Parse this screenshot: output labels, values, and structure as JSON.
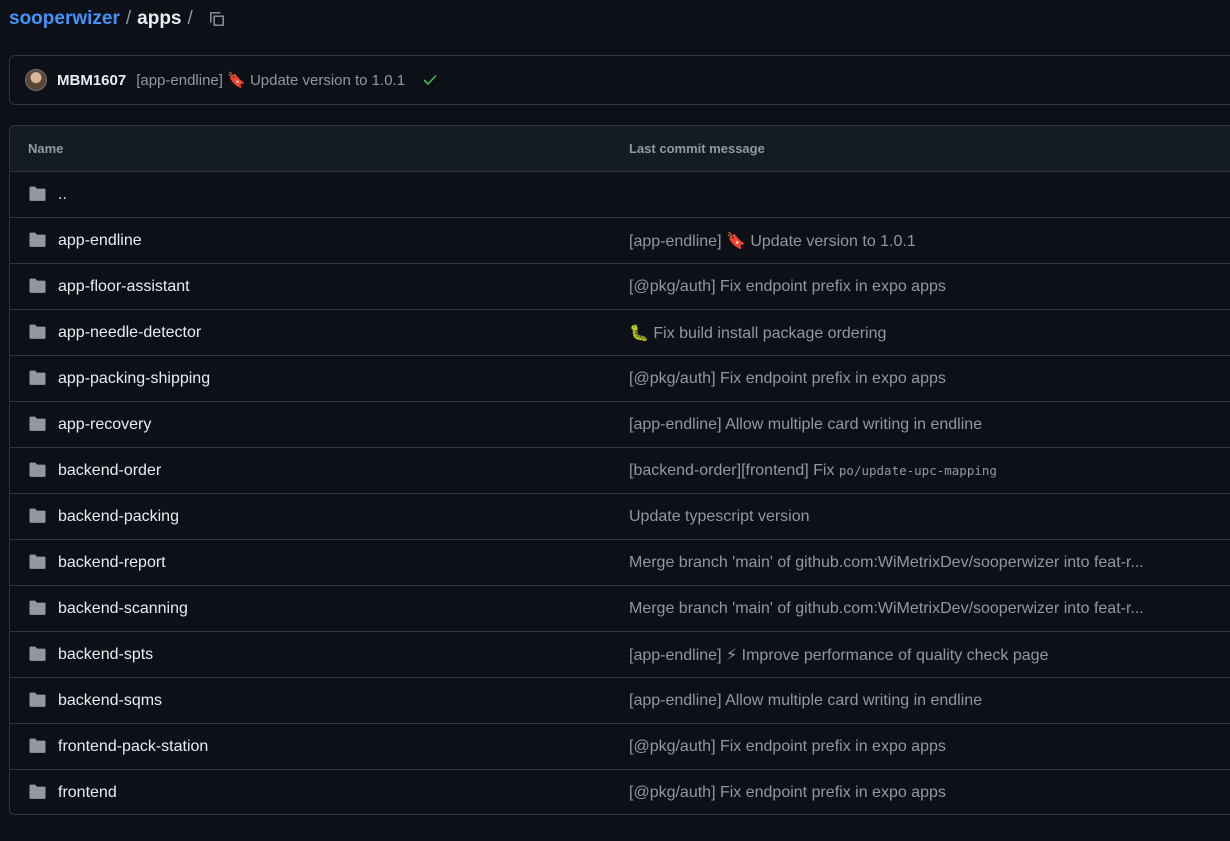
{
  "breadcrumb": {
    "repo": "sooperwizer",
    "separator": "/",
    "current": "apps",
    "trailing_separator": "/",
    "copy_icon": "copy-icon"
  },
  "latest_commit": {
    "author": "MBM1607",
    "message": "[app-endline] 🔖 Update version to 1.0.1",
    "status": "success",
    "status_color": "#3fb950"
  },
  "table": {
    "headers": {
      "name": "Name",
      "message": "Last commit message"
    },
    "rows": [
      {
        "name": "..",
        "message": ""
      },
      {
        "name": "app-endline",
        "message": "[app-endline] 🔖 Update version to 1.0.1"
      },
      {
        "name": "app-floor-assistant",
        "message": "[@pkg/auth] Fix endpoint prefix in expo apps"
      },
      {
        "name": "app-needle-detector",
        "message": "🐛 Fix build install package ordering"
      },
      {
        "name": "app-packing-shipping",
        "message": "[@pkg/auth] Fix endpoint prefix in expo apps"
      },
      {
        "name": "app-recovery",
        "message": "[app-endline] Allow multiple card writing in endline"
      },
      {
        "name": "backend-order",
        "message": "[backend-order][frontend] Fix ",
        "message_code": "po/update-upc-mapping"
      },
      {
        "name": "backend-packing",
        "message": "Update typescript version"
      },
      {
        "name": "backend-report",
        "message": "Merge branch 'main' of github.com:WiMetrixDev/sooperwizer into feat-r..."
      },
      {
        "name": "backend-scanning",
        "message": "Merge branch 'main' of github.com:WiMetrixDev/sooperwizer into feat-r..."
      },
      {
        "name": "backend-spts",
        "message": "[app-endline] ⚡ Improve performance of quality check page"
      },
      {
        "name": "backend-sqms",
        "message": "[app-endline] Allow multiple card writing in endline"
      },
      {
        "name": "frontend-pack-station",
        "message": "[@pkg/auth] Fix endpoint prefix in expo apps"
      },
      {
        "name": "frontend",
        "message": "[@pkg/auth] Fix endpoint prefix in expo apps"
      }
    ]
  },
  "colors": {
    "background": "#0d1117",
    "border": "#30363d",
    "link": "#4493f8",
    "muted": "#9198a1",
    "folder": "#9198a1"
  }
}
